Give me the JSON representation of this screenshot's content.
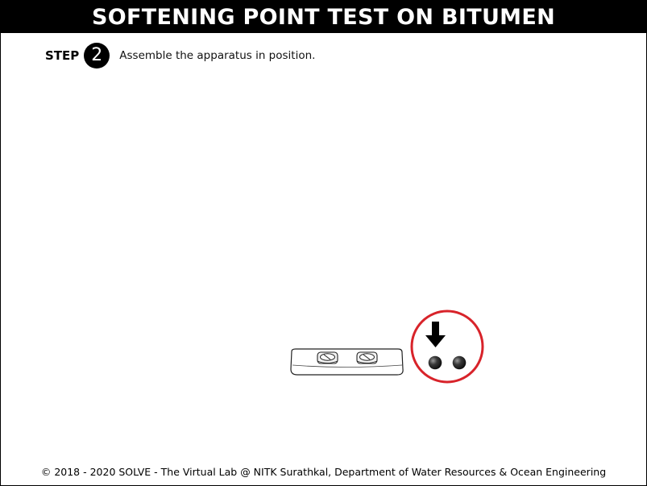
{
  "title": "SOFTENING POINT TEST ON BITUMEN",
  "step": {
    "label": "STEP",
    "number": "2",
    "instruction": "Assemble the apparatus in position."
  },
  "apparatus": {
    "ring_holder_plate": "ring-plate-with-two-rings",
    "steel_balls_count": 2,
    "highlight_color": "#d8232a",
    "indicator_icon": "down-arrow-icon"
  },
  "footer": {
    "text": "© 2018 - 2020 SOLVE - The Virtual Lab @ NITK Surathkal, Department of Water Resources & Ocean Engineering"
  }
}
